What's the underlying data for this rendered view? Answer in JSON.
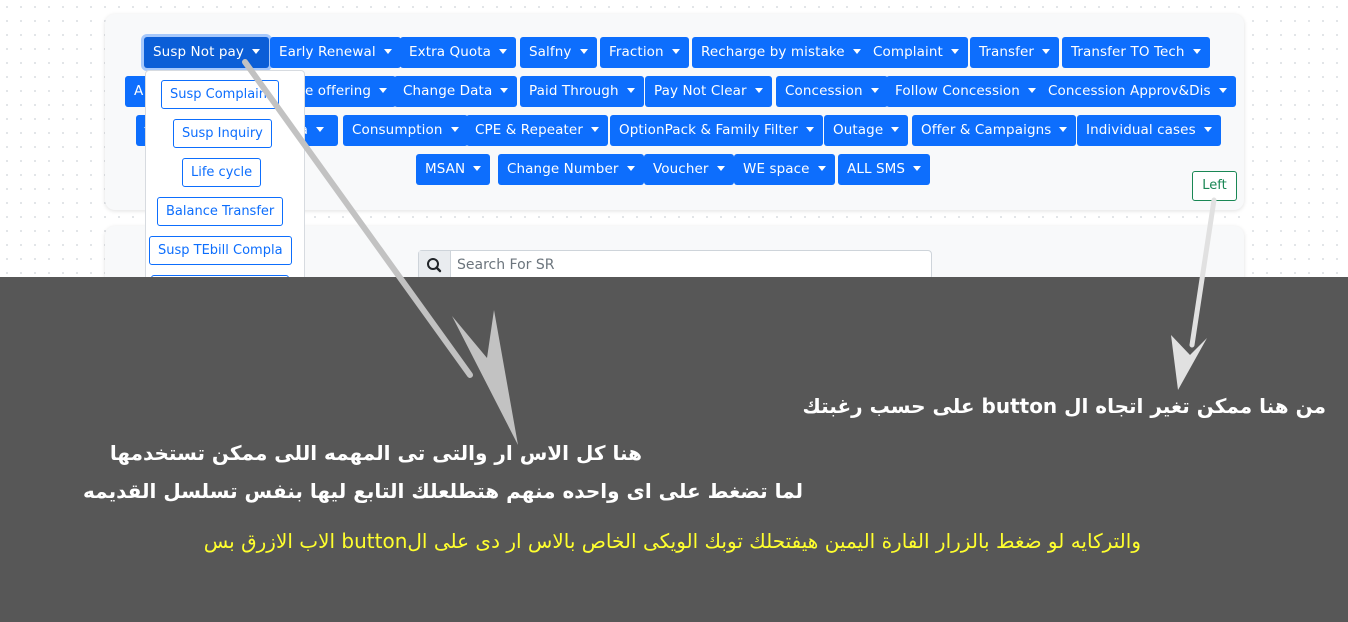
{
  "toolbar": {
    "row1": [
      "Susp Not pay",
      "Early Renewal",
      "Extra Quota",
      "Salfny",
      "Fraction",
      "Recharge by mistake",
      "Complaint",
      "Transfer",
      "Transfer TO Tech"
    ],
    "row2": [
      "A",
      "e offering",
      "Change Data",
      "Paid Through",
      "Pay Not Clear",
      "Concession",
      "Follow Concession",
      "Concession Approv&Dis"
    ],
    "row3": [
      "ra",
      "Consumption",
      "CPE & Repeater",
      "OptionPack & Family Filter",
      "Outage",
      "Offer & Campaigns",
      "Individual cases"
    ],
    "row4": [
      "MSAN",
      "Change Number",
      "Voucher",
      "WE space",
      "ALL SMS"
    ]
  },
  "dropdown": {
    "items": [
      "Susp Complain",
      "Susp Inquiry",
      "Life cycle",
      "Balance Transfer",
      "Susp TEbill Compla"
    ]
  },
  "direction_button": {
    "label": "Left"
  },
  "search": {
    "placeholder": "Search For SR"
  },
  "annotations": {
    "note_right": "من هنا ممكن تغير اتجاه ال button على  حسب رغبتك",
    "note_center_1": "هنا كل الاس ار والتى تى المهمه اللى ممكن تستخدمها",
    "note_center_2": "لما تضغط على اى واحده منهم هتطلعلك التابع ليها  بنفس تسلسل القديمه",
    "note_yellow": "والتركايه لو ضغط بالزرار الفارة اليمين هيفتحلك توبك الويكى الخاص بالاس ار دى على الbutton الاب الازرق بس"
  },
  "colors": {
    "primary": "#0d6efd",
    "success": "#198754",
    "overlay": "#575757",
    "highlight_text": "#ffff2e"
  }
}
